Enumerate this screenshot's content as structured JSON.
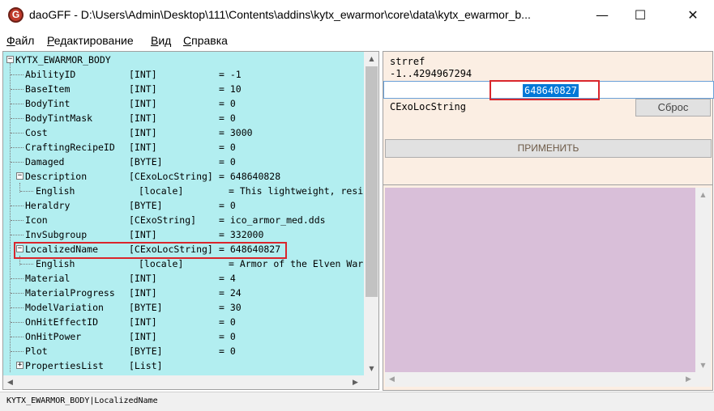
{
  "window": {
    "title": "daoGFF - D:\\Users\\Admin\\Desktop\\111\\Contents\\addins\\kytx_ewarmor\\core\\data\\kytx_ewarmor_b...",
    "icon_letter": "G",
    "minimize_glyph": "—",
    "maximize_glyph": "☐",
    "close_glyph": "✕"
  },
  "menu": {
    "file": {
      "acc": "Ф",
      "rest": "айл"
    },
    "edit": {
      "acc": "Р",
      "rest": "едактирование"
    },
    "view": {
      "acc": "В",
      "rest": "ид"
    },
    "help": {
      "acc": "С",
      "rest": "правка"
    }
  },
  "tree": {
    "root": "KYTX_EWARMOR_BODY",
    "rows": [
      {
        "name": "AbilityID",
        "type": "[INT]",
        "value": "= -1"
      },
      {
        "name": "BaseItem",
        "type": "[INT]",
        "value": "= 10"
      },
      {
        "name": "BodyTint",
        "type": "[INT]",
        "value": "= 0"
      },
      {
        "name": "BodyTintMask",
        "type": "[INT]",
        "value": "= 0"
      },
      {
        "name": "Cost",
        "type": "[INT]",
        "value": "= 3000"
      },
      {
        "name": "CraftingRecipeID",
        "type": "[INT]",
        "value": "= 0"
      },
      {
        "name": "Damaged",
        "type": "[BYTE]",
        "value": "= 0"
      },
      {
        "name": "Description",
        "type": "[CExoLocString]",
        "value": "= 648640828"
      },
      {
        "name": "English",
        "type": "[locale]",
        "value": "= This lightweight, resi"
      },
      {
        "name": "Heraldry",
        "type": "[BYTE]",
        "value": "= 0"
      },
      {
        "name": "Icon",
        "type": "[CExoString]",
        "value": "= ico_armor_med.dds"
      },
      {
        "name": "InvSubgroup",
        "type": "[INT]",
        "value": "= 332000"
      },
      {
        "name": "LocalizedName",
        "type": "[CExoLocString]",
        "value": "= 648640827"
      },
      {
        "name": "English",
        "type": "[locale]",
        "value": "= Armor of the Elven War"
      },
      {
        "name": "Material",
        "type": "[INT]",
        "value": "= 4"
      },
      {
        "name": "MaterialProgress",
        "type": "[INT]",
        "value": "= 24"
      },
      {
        "name": "ModelVariation",
        "type": "[BYTE]",
        "value": "= 30"
      },
      {
        "name": "OnHitEffectID",
        "type": "[INT]",
        "value": "= 0"
      },
      {
        "name": "OnHitPower",
        "type": "[INT]",
        "value": "= 0"
      },
      {
        "name": "Plot",
        "type": "[BYTE]",
        "value": "= 0"
      },
      {
        "name": "PropertiesList",
        "type": "[List]",
        "value": ""
      }
    ]
  },
  "editor": {
    "field_type": "strref",
    "range": "-1..4294967294",
    "value": "648640827",
    "type_label": "CExoLocString",
    "reset_label": "Сброс",
    "apply_label": "ПРИМЕНИТЬ"
  },
  "status": {
    "path": "KYTX_EWARMOR_BODY|LocalizedName"
  },
  "colors": {
    "tree_bg": "#b2eef0",
    "editor_bg": "#fbeee3",
    "text_area_bg": "#d9bfd9",
    "highlight": "#d9262c",
    "selection": "#0078d7"
  }
}
